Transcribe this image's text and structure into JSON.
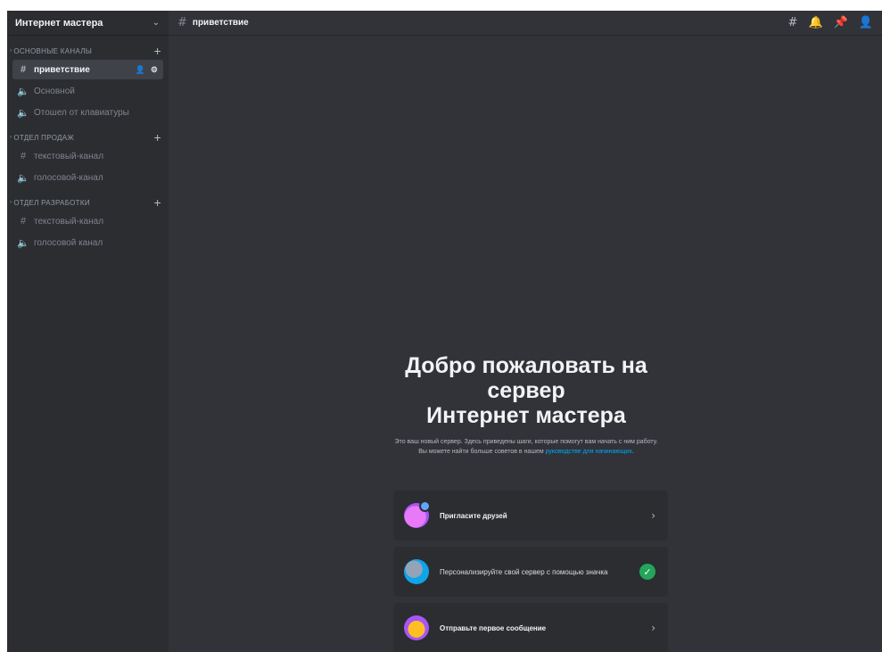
{
  "server": {
    "name": "Интернет мастера"
  },
  "sidebar": {
    "categories": [
      {
        "label": "ОСНОВНЫЕ КАНАЛЫ",
        "channels": [
          {
            "type": "text",
            "label": "приветствие",
            "active": true
          },
          {
            "type": "voice",
            "label": "Основной"
          },
          {
            "type": "voice",
            "label": "Отошел от клавиатуры"
          }
        ]
      },
      {
        "label": "ОТДЕЛ ПРОДАЖ",
        "channels": [
          {
            "type": "text",
            "label": "текстовый-канал"
          },
          {
            "type": "voice",
            "label": "голосовой-канал"
          }
        ]
      },
      {
        "label": "ОТДЕЛ РАЗРАБОТКИ",
        "channels": [
          {
            "type": "text",
            "label": "текстовый-канал"
          },
          {
            "type": "voice",
            "label": "голосовой канал"
          }
        ]
      }
    ]
  },
  "topbar": {
    "channel": "приветствие"
  },
  "welcome": {
    "title_line1": "Добро пожаловать на",
    "title_line2": "сервер",
    "title_line3": "Интернет мастера",
    "desc_before": "Это ваш новый сервер. Здесь приведены шаги, которые помогут вам начать с ним работу. Вы можете найти больше советов в нашем ",
    "desc_link": "руководстве для начинающих",
    "desc_after": "."
  },
  "cards": [
    {
      "label": "Пригласите друзей",
      "status": "arrow"
    },
    {
      "label": "Персонализируйте свой сервер с помощью значка",
      "status": "done"
    },
    {
      "label": "Отправьте первое сообщение",
      "status": "arrow"
    }
  ],
  "colors": {
    "background": "#313338",
    "sidebar": "#2b2d31",
    "link": "#00a8fc",
    "success": "#23a55a"
  }
}
